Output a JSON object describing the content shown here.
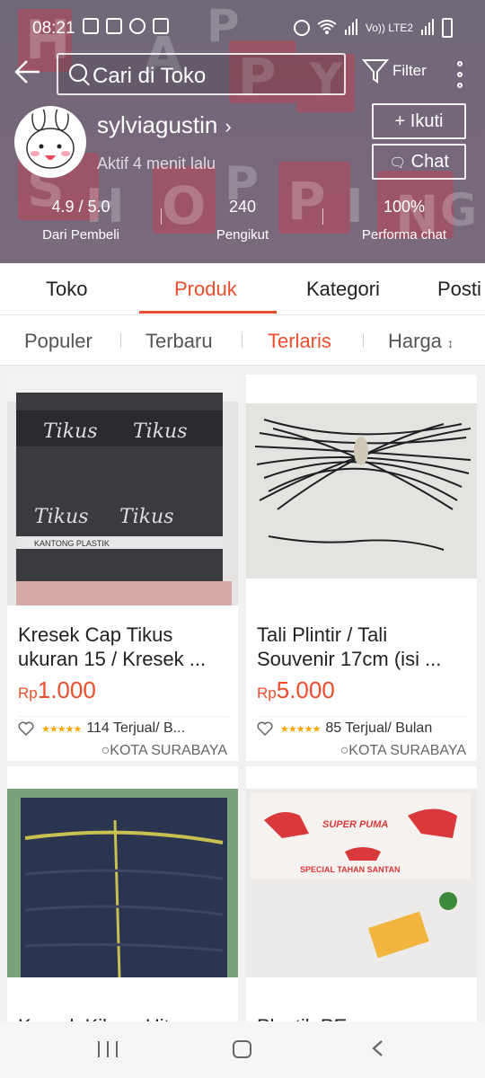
{
  "statusbar": {
    "time": "08:21",
    "network_label": "Vo)) LTE2"
  },
  "search": {
    "placeholder": "Cari di Toko"
  },
  "header": {
    "filter_label": "Filter"
  },
  "shop": {
    "name": "sylviagustin",
    "active_status": "Aktif 4 menit lalu",
    "follow_label": "+ Ikuti",
    "chat_label": "Chat"
  },
  "background_letters": [
    "H",
    "A",
    "P",
    "P",
    "Y",
    "S",
    "H",
    "O",
    "P",
    "P",
    "I",
    "N",
    "G"
  ],
  "stats": [
    {
      "value": "4.9 / 5.0",
      "label": "Dari Pembeli"
    },
    {
      "value": "240",
      "label": "Pengikut"
    },
    {
      "value": "100%",
      "label": "Performa chat"
    }
  ],
  "tabs": [
    "Toko",
    "Produk",
    "Kategori",
    "Posti"
  ],
  "active_tab": "Produk",
  "sorts": [
    "Populer",
    "Terbaru",
    "Terlaris",
    "Harga"
  ],
  "active_sort": "Terlaris",
  "products": [
    {
      "title": "Kresek Cap Tikus ukuran 15 / Kresek ...",
      "currency": "Rp",
      "price": "1.000",
      "rating": 4.5,
      "sold": "114 Terjual/ B...",
      "location": "KOTA SURABAYA"
    },
    {
      "title": "Tali Plintir / Tali Souvenir 17cm (isi ...",
      "currency": "Rp",
      "price": "5.000",
      "rating": 4.5,
      "sold": "85 Terjual/ Bulan",
      "location": "KOTA SURABAYA"
    },
    {
      "title": "Kresek Kiloan Hitam",
      "currency": "",
      "price": "",
      "rating": null,
      "sold": "",
      "location": ""
    },
    {
      "title": "Plastik PE cap",
      "currency": "",
      "price": "",
      "rating": null,
      "sold": "",
      "location": ""
    }
  ],
  "product_image_text": {
    "tikus": [
      "Tikus",
      "Tikus",
      "Tikus",
      "Tikus",
      "KANTONG PLASTIK"
    ],
    "puma": [
      "SUPER PUMA",
      "SPECIAL TAHAN SANTAN"
    ]
  },
  "colors": {
    "accent": "#ee4d2d",
    "star": "#f6a700",
    "header_overlay": "#75677a"
  }
}
